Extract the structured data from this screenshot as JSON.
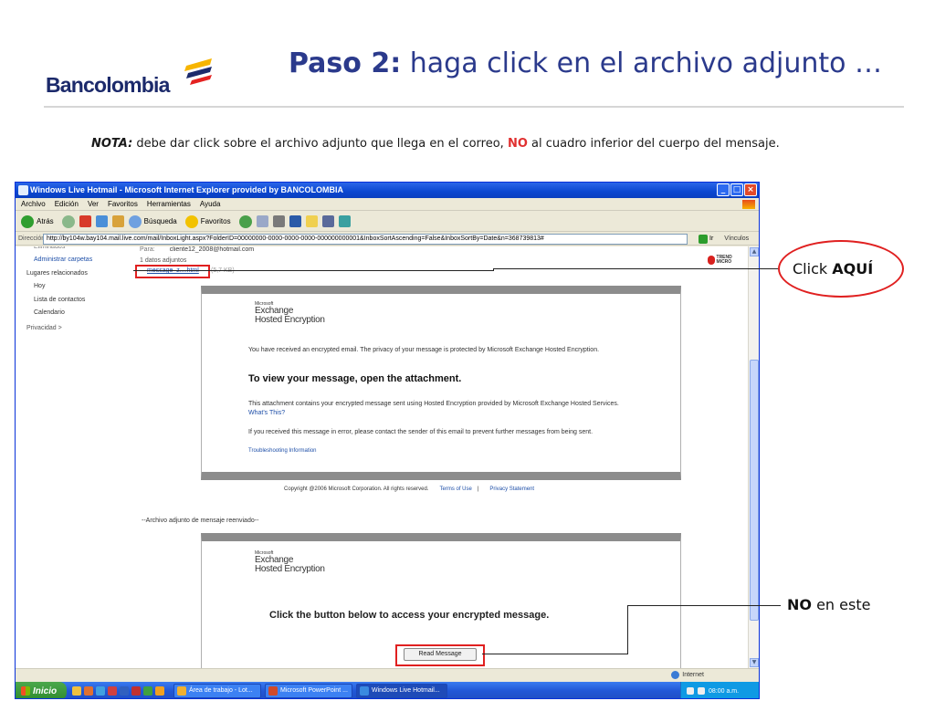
{
  "slide": {
    "logo_text": "Bancolombia",
    "title_bold": "Paso 2:",
    "title_rest": " haga click en el archivo adjunto …",
    "nota_label": "NOTA:",
    "nota_text_1": " debe dar click sobre el archivo adjunto que llega en el correo, ",
    "nota_no": "NO",
    "nota_text_2": " al cuadro inferior del cuerpo del mensaje."
  },
  "callouts": {
    "click_prefix": "Click ",
    "click_bold": "AQUÍ",
    "no_bold": "NO",
    "no_rest": " en este"
  },
  "window": {
    "title_app": "Windows Live Hotmail - ",
    "title_browser": "Microsoft Internet Explorer provided by BANCOLOMBIA",
    "menu": [
      "Archivo",
      "Edición",
      "Ver",
      "Favoritos",
      "Herramientas",
      "Ayuda"
    ],
    "toolbar": {
      "back": "Atrás",
      "search": "Búsqueda",
      "favorites": "Favoritos"
    },
    "address_label": "Dirección",
    "address_url": "http://by104w.bay104.mail.live.com/mail/InboxLight.aspx?FolderID=00000000-0000-0000-0000-000000000001&InboxSortAscending=False&InboxSortBy=Date&n=368739813#",
    "go_label": "Ir",
    "links_label": "Vínculos"
  },
  "sidebar": {
    "items": [
      "Eliminados",
      "Administrar carpetas",
      "Lugares relacionados",
      "Hoy",
      "Lista de contactos",
      "Calendario",
      "Privacidad >"
    ]
  },
  "mail": {
    "to_label": "Para:",
    "to_value": "cliente12_2008@hotmail.com",
    "attach_count": "1 datos adjuntos",
    "attach_name": "message_z....html",
    "attach_size": "(5,7 KB)",
    "trend_logo": "TREND MICRO",
    "box1": {
      "ms_small": "Microsoft",
      "ms_line1": "Exchange",
      "ms_line2": "Hosted Encryption",
      "intro": "You have received an encrypted email. The privacy of your message is protected by Microsoft Exchange Hosted Encryption.",
      "headline": "To view your message, open the attachment.",
      "body": "This attachment contains your encrypted message sent using Hosted Encryption provided by Microsoft Exchange Hosted Services. ",
      "whats_this": "What's This?",
      "error_text": "If you received this message in error, please contact the sender of this email to prevent further messages from being sent.",
      "troubleshooting": "Troubleshooting Information"
    },
    "copyright": "Copyright @2006 Microsoft Corporation. All rights reserved.",
    "terms": "Terms of Use",
    "privacy": "Privacy Statement",
    "forwarded": "--Archivo adjunto de mensaje reenviado--",
    "box2": {
      "ms_small": "Microsoft",
      "ms_line1": "Exchange",
      "ms_line2": "Hosted Encryption",
      "prompt": "Click the button below to access your encrypted message.",
      "button": "Read Message"
    }
  },
  "status": {
    "zone": "Internet"
  },
  "taskbar": {
    "start": "Inicio",
    "tasks": [
      "Área de trabajo - Lot...",
      "Microsoft PowerPoint ...",
      "Windows Live Hotmail..."
    ],
    "clock": "08:00 a.m."
  }
}
